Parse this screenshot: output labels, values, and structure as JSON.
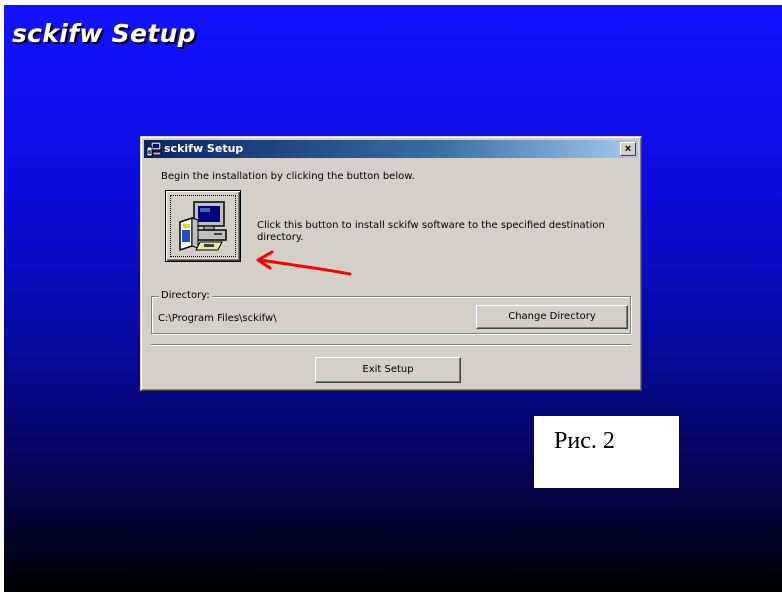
{
  "setup_title": "sckifw Setup",
  "dialog": {
    "title": "sckifw Setup",
    "close_glyph": "×",
    "instruction": "Begin the installation by clicking the button below.",
    "install_button_icon": "computer-install-icon",
    "install_description": "Click this button to install sckifw software to the specified destination directory.",
    "directory": {
      "label": "Directory:",
      "path": "C:\\Program Files\\sckifw\\",
      "change_button": "Change Directory"
    },
    "exit_button": "Exit Setup"
  },
  "annotation": {
    "arrow_color": "#ff0000",
    "caption": "Рис. 2"
  },
  "colors": {
    "background_top": "#1212ff",
    "background_bottom": "#000000",
    "titlebar_start": "#0a246a",
    "titlebar_end": "#a6caf0",
    "dialog_face": "#d4d0c8"
  }
}
